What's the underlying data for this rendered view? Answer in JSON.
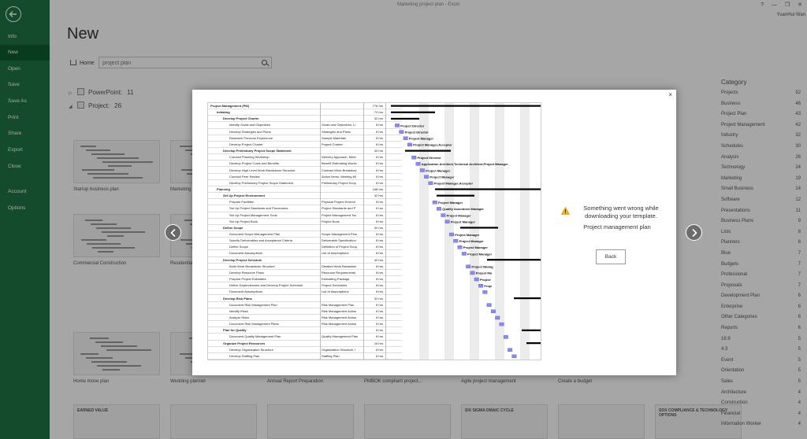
{
  "window": {
    "title": "Marketing project plan - Excel",
    "user": "YuanHui Wan",
    "help": "?",
    "minimize": "—",
    "restore": "❐",
    "close": "✕"
  },
  "sidebar": {
    "items": [
      {
        "label": "Info"
      },
      {
        "label": "New",
        "active": true
      },
      {
        "label": "Open"
      },
      {
        "label": "Save"
      },
      {
        "label": "Save As"
      },
      {
        "label": "Print"
      },
      {
        "label": "Share"
      },
      {
        "label": "Export"
      },
      {
        "label": "Close"
      },
      {
        "label": "Account"
      },
      {
        "label": "Options"
      }
    ]
  },
  "main": {
    "page_title": "New",
    "home_label": "Home",
    "search": {
      "value": "project plan",
      "placeholder": "project plan"
    },
    "groups": [
      {
        "name": "PowerPoint:",
        "count": "11",
        "expanded": false
      },
      {
        "name": "Project:",
        "count": "26",
        "expanded": true
      }
    ],
    "thumbnails": [
      {
        "label": "Startup business plan"
      },
      {
        "label": "Marketing"
      },
      {
        "label": "Commercial Construction"
      },
      {
        "label": "Residential"
      },
      {
        "label": "Home move plan"
      },
      {
        "label": "Wedding planner"
      },
      {
        "label": "Annual Report Preparation"
      },
      {
        "label": "PMBOK compliant project..."
      },
      {
        "label": "Agile project management"
      },
      {
        "label": "Create a budget"
      }
    ],
    "bottom_thumbnails": [
      {
        "label": "EARNED VALUE"
      },
      {
        "label": ""
      },
      {
        "label": ""
      },
      {
        "label": ""
      },
      {
        "label": "SIX SIGMA DMAIC CYCLE"
      },
      {
        "label": ""
      },
      {
        "label": "SOX COMPLIANCE & TECHNOLOGY OPTIONS"
      }
    ]
  },
  "category": {
    "title": "Category",
    "items": [
      {
        "name": "Projects",
        "count": "52"
      },
      {
        "name": "Business",
        "count": "46"
      },
      {
        "name": "Project Plan",
        "count": "43"
      },
      {
        "name": "Project Management",
        "count": "42"
      },
      {
        "name": "Industry",
        "count": "32"
      },
      {
        "name": "Schedules",
        "count": "30"
      },
      {
        "name": "Analysis",
        "count": "26"
      },
      {
        "name": "Technology",
        "count": "24"
      },
      {
        "name": "Marketing",
        "count": "19"
      },
      {
        "name": "Small Business",
        "count": "14"
      },
      {
        "name": "Software",
        "count": "12"
      },
      {
        "name": "Presentations",
        "count": "11"
      },
      {
        "name": "Business Plans",
        "count": "9"
      },
      {
        "name": "Lists",
        "count": "8"
      },
      {
        "name": "Planners",
        "count": "8"
      },
      {
        "name": "Blue",
        "count": "7"
      },
      {
        "name": "Budgets",
        "count": "7"
      },
      {
        "name": "Professional",
        "count": "7"
      },
      {
        "name": "Proposals",
        "count": "7"
      },
      {
        "name": "Development Plan",
        "count": "6"
      },
      {
        "name": "Enterprise",
        "count": "6"
      },
      {
        "name": "Other Categories",
        "count": "6"
      },
      {
        "name": "Reports",
        "count": "6"
      },
      {
        "name": "16:9",
        "count": "5"
      },
      {
        "name": "4:3",
        "count": "5"
      },
      {
        "name": "Event",
        "count": "5"
      },
      {
        "name": "Orientation",
        "count": "5"
      },
      {
        "name": "Sales",
        "count": "5"
      },
      {
        "name": "Architecture",
        "count": "4"
      },
      {
        "name": "Construction",
        "count": "4"
      },
      {
        "name": "Financial",
        "count": "4"
      },
      {
        "name": "Information Worker",
        "count": "4"
      }
    ]
  },
  "modal": {
    "close_label": "×",
    "error_message": "Something went wrong while downloading your template.",
    "template_name": "Project management plan",
    "back_label": "Back",
    "prev_icon": "chevron-left-icon",
    "next_icon": "chevron-right-icon",
    "preview": {
      "tasks": [
        {
          "name": "Project Management (PM)",
          "resource": "",
          "duration": "776 hrs",
          "level": 0,
          "summary": true
        },
        {
          "name": "Initiating",
          "resource": "",
          "duration": "72 hrs",
          "level": 1,
          "summary": true
        },
        {
          "name": "Develop Project Charter",
          "resource": "",
          "duration": "32 hrs",
          "level": 2,
          "summary": true
        },
        {
          "name": "Identify Goals and Objectives",
          "resource": "Goals and Objectives, Li",
          "duration": "8 hrs",
          "level": 3
        },
        {
          "name": "Develop Strategies and Plans",
          "resource": "Strategies and Plans",
          "duration": "8 hrs",
          "level": 3
        },
        {
          "name": "Research Previous Experience",
          "resource": "Sample Materials",
          "duration": "8 hrs",
          "level": 3
        },
        {
          "name": "Develop Project Charter",
          "resource": "Project Charter",
          "duration": "8 hrs",
          "level": 3
        },
        {
          "name": "Develop Preliminary Project Scope Statement",
          "resource": "",
          "duration": "40 hrs",
          "level": 2,
          "summary": true
        },
        {
          "name": "Conduct Planning Workshop",
          "resource": "Delivery Approach, Meet",
          "duration": "8 hrs",
          "level": 3
        },
        {
          "name": "Develop Project Costs and Benefits",
          "resource": "Benefit Estimating Works",
          "duration": "8 hrs",
          "level": 3
        },
        {
          "name": "Develop High Level Work Breakdown Structure",
          "resource": "Contract Work Breakdow",
          "duration": "8 hrs",
          "level": 3
        },
        {
          "name": "Conduct Peer Review",
          "resource": "Action Items, Meeting Mi",
          "duration": "8 hrs",
          "level": 3
        },
        {
          "name": "Develop Preliminary Project Scope Statement",
          "resource": "Preliminary Project Scop",
          "duration": "8 hrs",
          "level": 3
        },
        {
          "name": "Planning",
          "resource": "",
          "duration": "248 hrs",
          "level": 1,
          "summary": true
        },
        {
          "name": "Set Up Project Environment",
          "resource": "",
          "duration": "32 hrs",
          "level": 2,
          "summary": true
        },
        {
          "name": "Prepare Facilities",
          "resource": "Physical Project Environ",
          "duration": "8 hrs",
          "level": 3
        },
        {
          "name": "Set Up Project Standards and Procedures",
          "resource": "Project Standards and P",
          "duration": "8 hrs",
          "level": 3
        },
        {
          "name": "Set Up Project Management Tools",
          "resource": "Project Management Too",
          "duration": "8 hrs",
          "level": 3
        },
        {
          "name": "Set Up Project Book",
          "resource": "Project Book",
          "duration": "8 hrs",
          "level": 3
        },
        {
          "name": "Define Scope",
          "resource": "",
          "duration": "32 hrs",
          "level": 2,
          "summary": true
        },
        {
          "name": "Document Scope Management Plan",
          "resource": "Scope Management Plan",
          "duration": "8 hrs",
          "level": 3
        },
        {
          "name": "Specify Deliverables and Acceptance Criteria",
          "resource": "Deliverable Specification",
          "duration": "8 hrs",
          "level": 3
        },
        {
          "name": "Define Scope",
          "resource": "Definition of Project Scop",
          "duration": "8 hrs",
          "level": 3
        },
        {
          "name": "Document Assumptions",
          "resource": "List of Assumptions",
          "duration": "8 hrs",
          "level": 3
        },
        {
          "name": "Develop Project Schedule",
          "resource": "",
          "duration": "40 hrs",
          "level": 2,
          "summary": true
        },
        {
          "name": "Build Work Breakdown Structure",
          "resource": "Detailed Work Breakdow",
          "duration": "8 hrs",
          "level": 3
        },
        {
          "name": "Develop Resource Plans",
          "resource": "Resource Requirements",
          "duration": "8 hrs",
          "level": 3
        },
        {
          "name": "Prepare Project Estimates",
          "resource": "Estimating Package",
          "duration": "8 hrs",
          "level": 3
        },
        {
          "name": "Define Dependencies and Develop Project Schedule",
          "resource": "Project Schedules",
          "duration": "8 hrs",
          "level": 3
        },
        {
          "name": "Document Assumptions",
          "resource": "List of Assumptions",
          "duration": "8 hrs",
          "level": 3
        },
        {
          "name": "Develop Risk Plans",
          "resource": "",
          "duration": "32 hrs",
          "level": 2,
          "summary": true
        },
        {
          "name": "Document Risk Management Plan",
          "resource": "Risk Management Plan",
          "duration": "8 hrs",
          "level": 3
        },
        {
          "name": "Identify Risks",
          "resource": "Risk Management Action",
          "duration": "8 hrs",
          "level": 3
        },
        {
          "name": "Analyze Risks",
          "resource": "Risk Management Action",
          "duration": "8 hrs",
          "level": 3
        },
        {
          "name": "Document Risk Management Plans",
          "resource": "Risk Management Action",
          "duration": "8 hrs",
          "level": 3
        },
        {
          "name": "Plan for Quality",
          "resource": "",
          "duration": "8 hrs",
          "level": 2,
          "summary": true
        },
        {
          "name": "Document Quality Management Plan",
          "resource": "Quality Management Plan",
          "duration": "8 hrs",
          "level": 3
        },
        {
          "name": "Organize Project Resources",
          "resource": "",
          "duration": "16 hrs",
          "level": 2,
          "summary": true
        },
        {
          "name": "Develop Organization Structure",
          "resource": "Organization Structure, I",
          "duration": "8 hrs",
          "level": 3
        },
        {
          "name": "Develop Staffing Plan",
          "resource": "Staffing Plan",
          "duration": "8 hrs",
          "level": 3
        }
      ],
      "gantt_labels": [
        {
          "row": 3,
          "text": "Project Director"
        },
        {
          "row": 4,
          "text": "Project Director"
        },
        {
          "row": 5,
          "text": "Project Manager"
        },
        {
          "row": 6,
          "text": "Project Manager,Acceptor"
        },
        {
          "row": 8,
          "text": "Project Director"
        },
        {
          "row": 9,
          "text": "Application Architect,Technical Architect,Project Manager"
        },
        {
          "row": 10,
          "text": "Project Manager"
        },
        {
          "row": 11,
          "text": "Project Manager"
        },
        {
          "row": 12,
          "text": "Project Manager,Acceptor"
        },
        {
          "row": 15,
          "text": "Project Manager"
        },
        {
          "row": 16,
          "text": "Quality Assurance Manager"
        },
        {
          "row": 17,
          "text": "Project Manager"
        },
        {
          "row": 18,
          "text": "Project Manager"
        },
        {
          "row": 20,
          "text": "Project Manager"
        },
        {
          "row": 21,
          "text": "Project Manager"
        },
        {
          "row": 22,
          "text": "Project Manager"
        },
        {
          "row": 23,
          "text": "Project Manager"
        },
        {
          "row": 25,
          "text": "Project Manag"
        },
        {
          "row": 26,
          "text": "Project Ma"
        },
        {
          "row": 27,
          "text": "Project"
        },
        {
          "row": 28,
          "text": "Proje"
        }
      ]
    }
  }
}
